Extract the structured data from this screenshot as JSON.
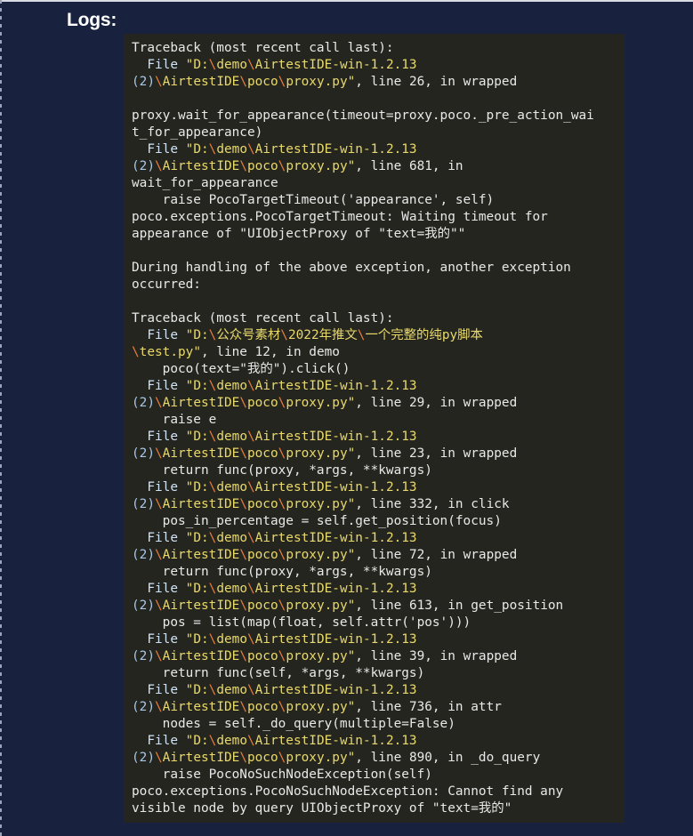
{
  "page": {
    "background_color": "#18223f",
    "title": "Logs:"
  },
  "log_panel": {
    "background_color": "#25251f",
    "colors": {
      "default_text": "#e8e8e8",
      "path_string": "#e8d96a",
      "backslash": "#e87d3e",
      "number_paren": "#a7c8e8"
    },
    "lines": [
      [
        {
          "t": "Traceback (most recent call last):",
          "c": "t-def"
        }
      ],
      [
        {
          "t": "  File ",
          "c": "t-blue"
        },
        {
          "t": "\"D:",
          "c": "t-path"
        },
        {
          "t": "\\",
          "c": "t-bs"
        },
        {
          "t": "demo",
          "c": "t-path"
        },
        {
          "t": "\\",
          "c": "t-bs"
        },
        {
          "t": "AirtestIDE-win-1.2.13",
          "c": "t-path"
        }
      ],
      [
        {
          "t": "(2)",
          "c": "t-num"
        },
        {
          "t": "\\",
          "c": "t-bs"
        },
        {
          "t": "AirtestIDE",
          "c": "t-path"
        },
        {
          "t": "\\",
          "c": "t-bs"
        },
        {
          "t": "poco",
          "c": "t-path"
        },
        {
          "t": "\\",
          "c": "t-bs"
        },
        {
          "t": "proxy.py\"",
          "c": "t-path"
        },
        {
          "t": ", line 26, in wrapped",
          "c": "t-def"
        }
      ],
      [
        {
          "t": "",
          "c": "t-def"
        }
      ],
      [
        {
          "t": "proxy.wait_for_appearance(timeout=proxy.poco._pre_action_wai",
          "c": "t-def"
        }
      ],
      [
        {
          "t": "t_for_appearance)",
          "c": "t-def"
        }
      ],
      [
        {
          "t": "  File ",
          "c": "t-blue"
        },
        {
          "t": "\"D:",
          "c": "t-path"
        },
        {
          "t": "\\",
          "c": "t-bs"
        },
        {
          "t": "demo",
          "c": "t-path"
        },
        {
          "t": "\\",
          "c": "t-bs"
        },
        {
          "t": "AirtestIDE-win-1.2.13",
          "c": "t-path"
        }
      ],
      [
        {
          "t": "(2)",
          "c": "t-num"
        },
        {
          "t": "\\",
          "c": "t-bs"
        },
        {
          "t": "AirtestIDE",
          "c": "t-path"
        },
        {
          "t": "\\",
          "c": "t-bs"
        },
        {
          "t": "poco",
          "c": "t-path"
        },
        {
          "t": "\\",
          "c": "t-bs"
        },
        {
          "t": "proxy.py\"",
          "c": "t-path"
        },
        {
          "t": ", line 681, in",
          "c": "t-def"
        }
      ],
      [
        {
          "t": "wait_for_appearance",
          "c": "t-def"
        }
      ],
      [
        {
          "t": "    raise PocoTargetTimeout('appearance', self)",
          "c": "t-def"
        }
      ],
      [
        {
          "t": "poco.exceptions.PocoTargetTimeout: Waiting timeout for",
          "c": "t-def"
        }
      ],
      [
        {
          "t": "appearance of \"UIObjectProxy of \"text=我的\"\"",
          "c": "t-def"
        }
      ],
      [
        {
          "t": "",
          "c": "t-def"
        }
      ],
      [
        {
          "t": "During handling of the above exception, another exception",
          "c": "t-def"
        }
      ],
      [
        {
          "t": "occurred:",
          "c": "t-def"
        }
      ],
      [
        {
          "t": "",
          "c": "t-def"
        }
      ],
      [
        {
          "t": "Traceback (most recent call last):",
          "c": "t-def"
        }
      ],
      [
        {
          "t": "  File ",
          "c": "t-blue"
        },
        {
          "t": "\"D:",
          "c": "t-path"
        },
        {
          "t": "\\",
          "c": "t-bs"
        },
        {
          "t": "公众号素材",
          "c": "t-path"
        },
        {
          "t": "\\",
          "c": "t-bs"
        },
        {
          "t": "2022年推文",
          "c": "t-path"
        },
        {
          "t": "\\",
          "c": "t-bs"
        },
        {
          "t": "一个完整的纯py脚本",
          "c": "t-path"
        }
      ],
      [
        {
          "t": "\\",
          "c": "t-bs"
        },
        {
          "t": "test.py\"",
          "c": "t-path"
        },
        {
          "t": ", line 12, in demo",
          "c": "t-def"
        }
      ],
      [
        {
          "t": "    poco(text=\"我的\").click()",
          "c": "t-def"
        }
      ],
      [
        {
          "t": "  File ",
          "c": "t-blue"
        },
        {
          "t": "\"D:",
          "c": "t-path"
        },
        {
          "t": "\\",
          "c": "t-bs"
        },
        {
          "t": "demo",
          "c": "t-path"
        },
        {
          "t": "\\",
          "c": "t-bs"
        },
        {
          "t": "AirtestIDE-win-1.2.13",
          "c": "t-path"
        }
      ],
      [
        {
          "t": "(2)",
          "c": "t-num"
        },
        {
          "t": "\\",
          "c": "t-bs"
        },
        {
          "t": "AirtestIDE",
          "c": "t-path"
        },
        {
          "t": "\\",
          "c": "t-bs"
        },
        {
          "t": "poco",
          "c": "t-path"
        },
        {
          "t": "\\",
          "c": "t-bs"
        },
        {
          "t": "proxy.py\"",
          "c": "t-path"
        },
        {
          "t": ", line 29, in wrapped",
          "c": "t-def"
        }
      ],
      [
        {
          "t": "    raise e",
          "c": "t-def"
        }
      ],
      [
        {
          "t": "  File ",
          "c": "t-blue"
        },
        {
          "t": "\"D:",
          "c": "t-path"
        },
        {
          "t": "\\",
          "c": "t-bs"
        },
        {
          "t": "demo",
          "c": "t-path"
        },
        {
          "t": "\\",
          "c": "t-bs"
        },
        {
          "t": "AirtestIDE-win-1.2.13",
          "c": "t-path"
        }
      ],
      [
        {
          "t": "(2)",
          "c": "t-num"
        },
        {
          "t": "\\",
          "c": "t-bs"
        },
        {
          "t": "AirtestIDE",
          "c": "t-path"
        },
        {
          "t": "\\",
          "c": "t-bs"
        },
        {
          "t": "poco",
          "c": "t-path"
        },
        {
          "t": "\\",
          "c": "t-bs"
        },
        {
          "t": "proxy.py\"",
          "c": "t-path"
        },
        {
          "t": ", line 23, in wrapped",
          "c": "t-def"
        }
      ],
      [
        {
          "t": "    return func(proxy, *args, **kwargs)",
          "c": "t-def"
        }
      ],
      [
        {
          "t": "  File ",
          "c": "t-blue"
        },
        {
          "t": "\"D:",
          "c": "t-path"
        },
        {
          "t": "\\",
          "c": "t-bs"
        },
        {
          "t": "demo",
          "c": "t-path"
        },
        {
          "t": "\\",
          "c": "t-bs"
        },
        {
          "t": "AirtestIDE-win-1.2.13",
          "c": "t-path"
        }
      ],
      [
        {
          "t": "(2)",
          "c": "t-num"
        },
        {
          "t": "\\",
          "c": "t-bs"
        },
        {
          "t": "AirtestIDE",
          "c": "t-path"
        },
        {
          "t": "\\",
          "c": "t-bs"
        },
        {
          "t": "poco",
          "c": "t-path"
        },
        {
          "t": "\\",
          "c": "t-bs"
        },
        {
          "t": "proxy.py\"",
          "c": "t-path"
        },
        {
          "t": ", line 332, in click",
          "c": "t-def"
        }
      ],
      [
        {
          "t": "    pos_in_percentage = self.get_position(focus)",
          "c": "t-def"
        }
      ],
      [
        {
          "t": "  File ",
          "c": "t-blue"
        },
        {
          "t": "\"D:",
          "c": "t-path"
        },
        {
          "t": "\\",
          "c": "t-bs"
        },
        {
          "t": "demo",
          "c": "t-path"
        },
        {
          "t": "\\",
          "c": "t-bs"
        },
        {
          "t": "AirtestIDE-win-1.2.13",
          "c": "t-path"
        }
      ],
      [
        {
          "t": "(2)",
          "c": "t-num"
        },
        {
          "t": "\\",
          "c": "t-bs"
        },
        {
          "t": "AirtestIDE",
          "c": "t-path"
        },
        {
          "t": "\\",
          "c": "t-bs"
        },
        {
          "t": "poco",
          "c": "t-path"
        },
        {
          "t": "\\",
          "c": "t-bs"
        },
        {
          "t": "proxy.py\"",
          "c": "t-path"
        },
        {
          "t": ", line 72, in wrapped",
          "c": "t-def"
        }
      ],
      [
        {
          "t": "    return func(proxy, *args, **kwargs)",
          "c": "t-def"
        }
      ],
      [
        {
          "t": "  File ",
          "c": "t-blue"
        },
        {
          "t": "\"D:",
          "c": "t-path"
        },
        {
          "t": "\\",
          "c": "t-bs"
        },
        {
          "t": "demo",
          "c": "t-path"
        },
        {
          "t": "\\",
          "c": "t-bs"
        },
        {
          "t": "AirtestIDE-win-1.2.13",
          "c": "t-path"
        }
      ],
      [
        {
          "t": "(2)",
          "c": "t-num"
        },
        {
          "t": "\\",
          "c": "t-bs"
        },
        {
          "t": "AirtestIDE",
          "c": "t-path"
        },
        {
          "t": "\\",
          "c": "t-bs"
        },
        {
          "t": "poco",
          "c": "t-path"
        },
        {
          "t": "\\",
          "c": "t-bs"
        },
        {
          "t": "proxy.py\"",
          "c": "t-path"
        },
        {
          "t": ", line 613, in get_position",
          "c": "t-def"
        }
      ],
      [
        {
          "t": "    pos = list(map(float, self.attr('pos')))",
          "c": "t-def"
        }
      ],
      [
        {
          "t": "  File ",
          "c": "t-blue"
        },
        {
          "t": "\"D:",
          "c": "t-path"
        },
        {
          "t": "\\",
          "c": "t-bs"
        },
        {
          "t": "demo",
          "c": "t-path"
        },
        {
          "t": "\\",
          "c": "t-bs"
        },
        {
          "t": "AirtestIDE-win-1.2.13",
          "c": "t-path"
        }
      ],
      [
        {
          "t": "(2)",
          "c": "t-num"
        },
        {
          "t": "\\",
          "c": "t-bs"
        },
        {
          "t": "AirtestIDE",
          "c": "t-path"
        },
        {
          "t": "\\",
          "c": "t-bs"
        },
        {
          "t": "poco",
          "c": "t-path"
        },
        {
          "t": "\\",
          "c": "t-bs"
        },
        {
          "t": "proxy.py\"",
          "c": "t-path"
        },
        {
          "t": ", line 39, in wrapped",
          "c": "t-def"
        }
      ],
      [
        {
          "t": "    return func(self, *args, **kwargs)",
          "c": "t-def"
        }
      ],
      [
        {
          "t": "  File ",
          "c": "t-blue"
        },
        {
          "t": "\"D:",
          "c": "t-path"
        },
        {
          "t": "\\",
          "c": "t-bs"
        },
        {
          "t": "demo",
          "c": "t-path"
        },
        {
          "t": "\\",
          "c": "t-bs"
        },
        {
          "t": "AirtestIDE-win-1.2.13",
          "c": "t-path"
        }
      ],
      [
        {
          "t": "(2)",
          "c": "t-num"
        },
        {
          "t": "\\",
          "c": "t-bs"
        },
        {
          "t": "AirtestIDE",
          "c": "t-path"
        },
        {
          "t": "\\",
          "c": "t-bs"
        },
        {
          "t": "poco",
          "c": "t-path"
        },
        {
          "t": "\\",
          "c": "t-bs"
        },
        {
          "t": "proxy.py\"",
          "c": "t-path"
        },
        {
          "t": ", line 736, in attr",
          "c": "t-def"
        }
      ],
      [
        {
          "t": "    nodes = self._do_query(multiple=False)",
          "c": "t-def"
        }
      ],
      [
        {
          "t": "  File ",
          "c": "t-blue"
        },
        {
          "t": "\"D:",
          "c": "t-path"
        },
        {
          "t": "\\",
          "c": "t-bs"
        },
        {
          "t": "demo",
          "c": "t-path"
        },
        {
          "t": "\\",
          "c": "t-bs"
        },
        {
          "t": "AirtestIDE-win-1.2.13",
          "c": "t-path"
        }
      ],
      [
        {
          "t": "(2)",
          "c": "t-num"
        },
        {
          "t": "\\",
          "c": "t-bs"
        },
        {
          "t": "AirtestIDE",
          "c": "t-path"
        },
        {
          "t": "\\",
          "c": "t-bs"
        },
        {
          "t": "poco",
          "c": "t-path"
        },
        {
          "t": "\\",
          "c": "t-bs"
        },
        {
          "t": "proxy.py\"",
          "c": "t-path"
        },
        {
          "t": ", line 890, in _do_query",
          "c": "t-def"
        }
      ],
      [
        {
          "t": "    raise PocoNoSuchNodeException(self)",
          "c": "t-def"
        }
      ],
      [
        {
          "t": "poco.exceptions.PocoNoSuchNodeException: Cannot find any",
          "c": "t-def"
        }
      ],
      [
        {
          "t": "visible node by query UIObjectProxy of \"text=我的\"",
          "c": "t-def"
        }
      ]
    ]
  }
}
